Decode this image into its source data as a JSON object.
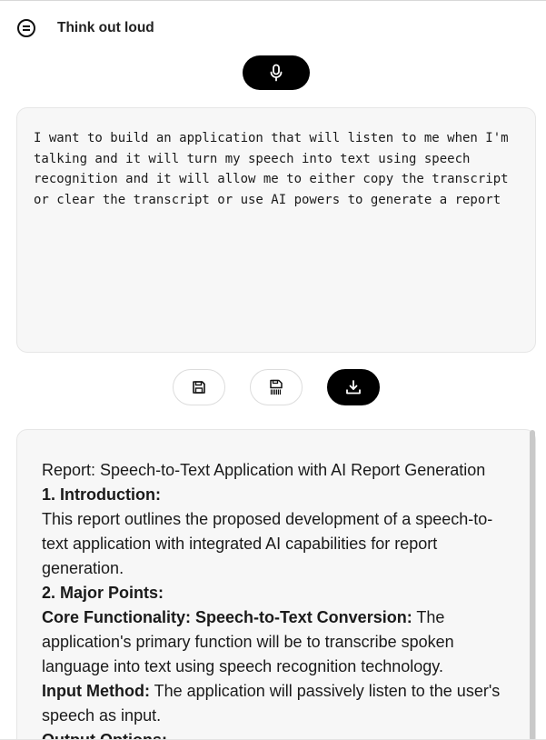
{
  "app": {
    "title": "Think out loud"
  },
  "icons": {
    "menu": "hamburger-menu-icon",
    "mic": "microphone-icon",
    "save": "floppy-disk-icon",
    "save_alt": "floppy-disk-barcode-icon",
    "download": "download-icon"
  },
  "colors": {
    "accent": "#000000",
    "panel_bg": "#f7f7f7",
    "panel_border": "#e6e6e6"
  },
  "transcript": {
    "text": "I want to build an application that will listen to me when I'm talking and it will turn my speech into text using speech recognition and it will allow me to either copy the transcript or clear the transcript or use AI powers to generate a report"
  },
  "report": {
    "title": "Report: Speech-to-Text Application with AI Report Generation",
    "section1_heading": "1. Introduction:",
    "section1_body": "This report outlines the proposed development of a speech-to-text application with integrated AI capabilities for report generation.",
    "section2_heading": "2. Major Points:",
    "point1_label": "Core Functionality: Speech-to-Text Conversion:",
    "point1_body": " The application's primary function will be to transcribe spoken language into text using speech recognition technology.",
    "point2_label": "Input Method:",
    "point2_body": " The application will passively listen to the user's speech as input.",
    "point3_label": "Output Options:"
  }
}
